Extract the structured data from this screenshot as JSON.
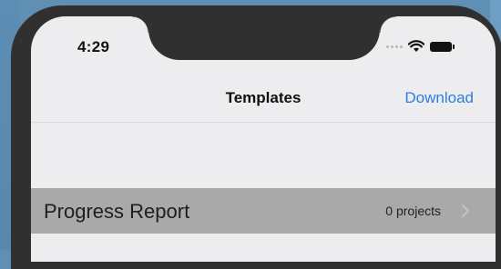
{
  "status_bar": {
    "time": "4:29"
  },
  "navbar": {
    "title": "Templates",
    "download_label": "Download"
  },
  "list": {
    "items": [
      {
        "title": "Progress Report",
        "detail": "0 projects"
      }
    ]
  },
  "colors": {
    "background": "#5f8fb3",
    "bezel": "#303030",
    "accent": "#2b7de0",
    "row_highlight": "#a9a9a9"
  },
  "icons": [
    "signal-dots-icon",
    "wifi-icon",
    "battery-icon",
    "chevron-right-icon"
  ]
}
